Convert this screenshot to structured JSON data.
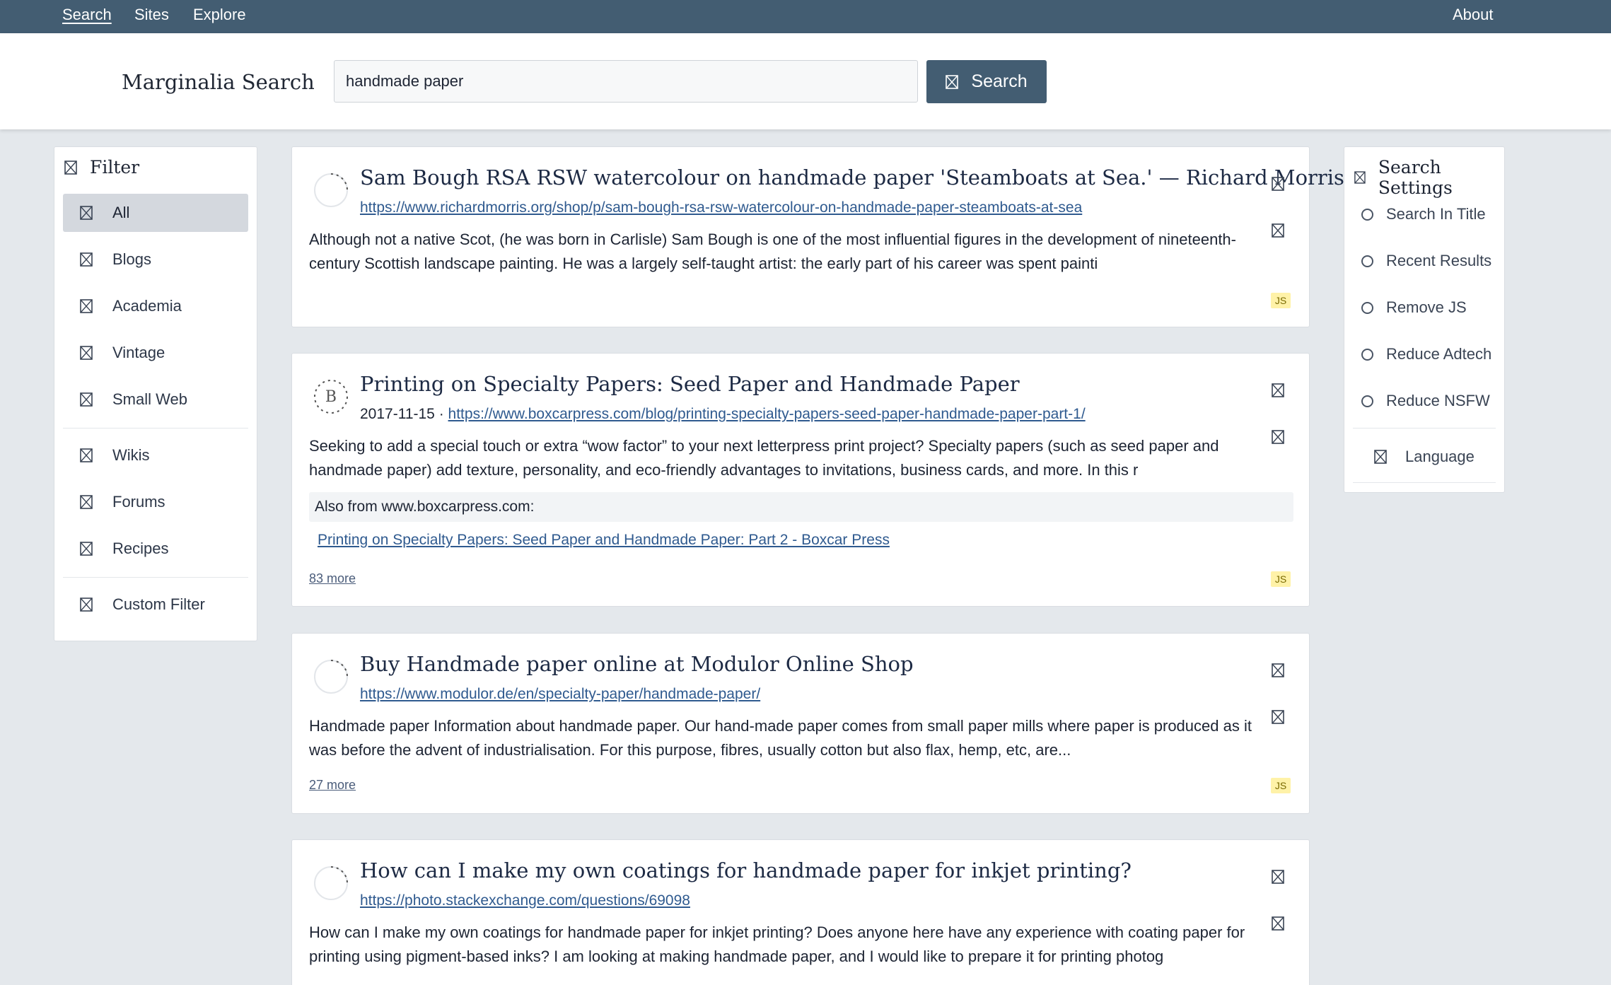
{
  "nav": {
    "search": "Search",
    "sites": "Sites",
    "explore": "Explore",
    "about": "About"
  },
  "header": {
    "brand": "Marginalia Search",
    "query": "handmade paper",
    "search_button": "Search"
  },
  "filter": {
    "title": "Filter",
    "items": [
      "All",
      "Blogs",
      "Academia",
      "Vintage",
      "Small Web",
      "Wikis",
      "Forums",
      "Recipes",
      "Custom Filter"
    ],
    "selected": "All"
  },
  "settings": {
    "title": "Search Settings",
    "options": [
      "Search In Title",
      "Recent Results",
      "Remove JS",
      "Reduce Adtech",
      "Reduce NSFW"
    ],
    "language": "Language"
  },
  "results": [
    {
      "title": "Sam Bough RSA RSW watercolour on handmade paper 'Steamboats at Sea.' — Richard Morris",
      "url": "https://www.richardmorris.org/shop/p/sam-bough-rsa-rsw-watercolour-on-handmade-paper-steamboats-at-sea",
      "desc": "Although not a native Scot, (he was born in Carlisle) Sam Bough is one of the most influential figures in the development of nineteenth-century Scottish landscape painting. He was a largely self-taught artist: the early part of his career was spent painti",
      "badge": "JS"
    },
    {
      "title": "Printing on Specialty Papers: Seed Paper and Handmade Paper",
      "date": "2017-11-15 ·",
      "url": "https://www.boxcarpress.com/blog/printing-specialty-papers-seed-paper-handmade-paper-part-1/",
      "desc": "Seeking to add a special touch or extra “wow factor” to your next letterpress print project? Specialty papers (such as seed paper and handmade paper) add texture, personality, and eco-friendly advantages to invitations, business cards, and more. In this r",
      "also_label": "Also from www.boxcarpress.com:",
      "also_link": "Printing on Specialty Papers: Seed Paper and Handmade Paper: Part 2 - Boxcar Press",
      "more": "83 more",
      "badge": "JS",
      "favicon_letter": "B"
    },
    {
      "title": "Buy Handmade paper online at Modulor Online Shop",
      "url": "https://www.modulor.de/en/specialty-paper/handmade-paper/",
      "desc": "Handmade paper Information about handmade paper. Our hand-made paper comes from small paper mills where paper is produced as it was before the advent of industrialisation. For this purpose, fibres, usually cotton but also flax, hemp, etc, are...",
      "more": "27 more",
      "badge": "JS"
    },
    {
      "title": "How can I make my own coatings for handmade paper for inkjet printing?",
      "url": "https://photo.stackexchange.com/questions/69098",
      "desc": "How can I make my own coatings for handmade paper for inkjet printing? Does anyone here have any experience with coating paper for printing using pigment-based inks? I am looking at making handmade paper, and I would like to prepare it for printing photog"
    }
  ]
}
